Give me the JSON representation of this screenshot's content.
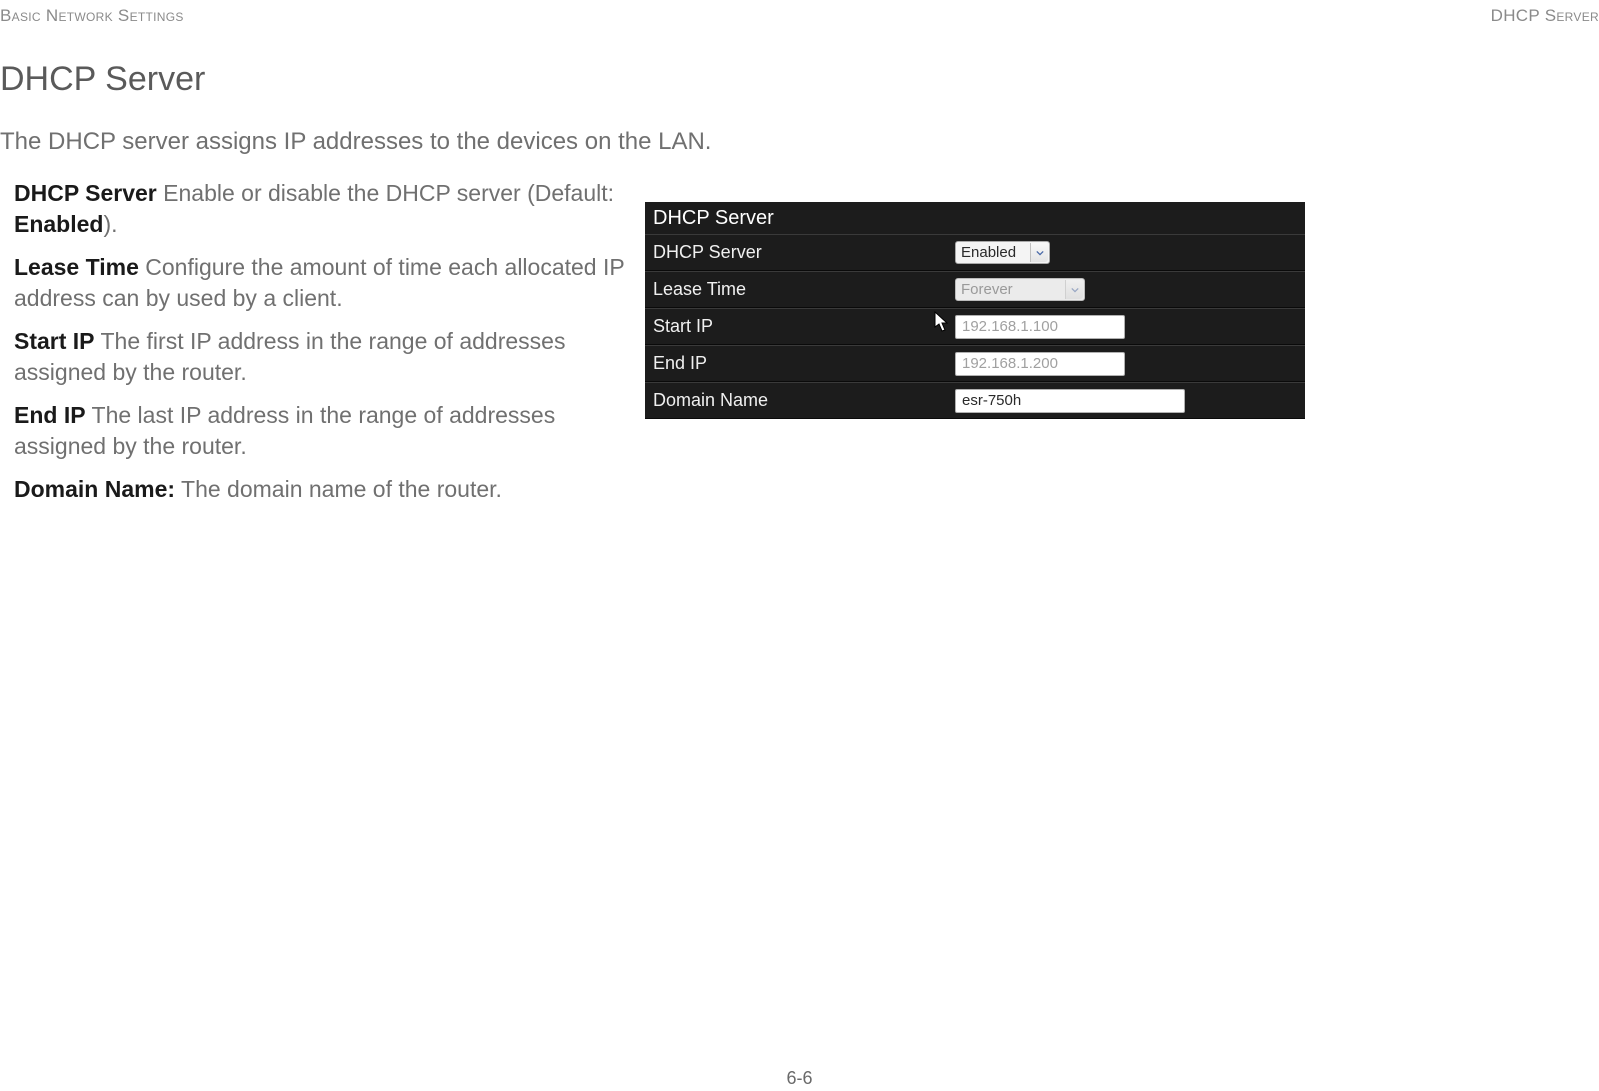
{
  "header": {
    "left": "Basic Network Settings",
    "right": "DHCP Server"
  },
  "title": "DHCP Server",
  "intro": "The DHCP server assigns IP addresses to the devices on the LAN.",
  "definitions": {
    "dhcp_server_label": "DHCP Server",
    "dhcp_server_desc_part1": "  Enable or disable the DHCP server (Default: ",
    "dhcp_server_default": "Enabled",
    "dhcp_server_desc_part2": ").",
    "lease_time_label": "Lease Time",
    "lease_time_desc": "  Configure the amount of time each allocated IP address can by used by a client.",
    "start_ip_label": "Start IP",
    "start_ip_desc": "  The first IP address in the range of addresses assigned by the router.",
    "end_ip_label": "End IP",
    "end_ip_desc": "  The last IP address in the range of addresses assigned by the router.",
    "domain_name_label": "Domain Name:",
    "domain_name_desc": " The domain name of the router."
  },
  "panel": {
    "title": "DHCP Server",
    "rows": {
      "dhcp_server": {
        "label": "DHCP Server",
        "value": "Enabled"
      },
      "lease_time": {
        "label": "Lease Time",
        "value": "Forever"
      },
      "start_ip": {
        "label": "Start IP",
        "value": "192.168.1.100"
      },
      "end_ip": {
        "label": "End IP",
        "value": "192.168.1.200"
      },
      "domain_name": {
        "label": "Domain Name",
        "value": "esr-750h"
      }
    }
  },
  "footer": {
    "page_number": "6-6"
  }
}
